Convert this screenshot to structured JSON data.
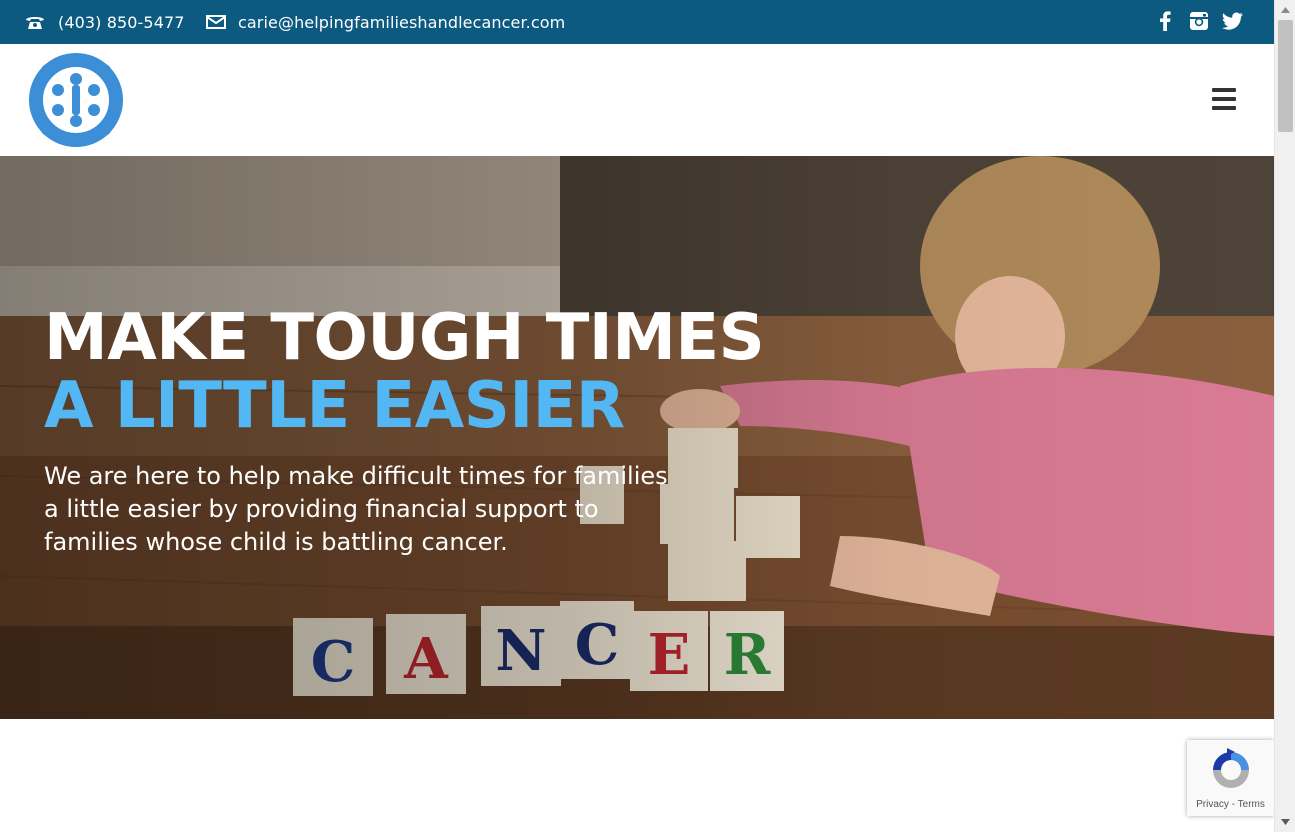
{
  "topbar": {
    "phone": "(403) 850-5477",
    "email": "carie@helpingfamilieshandlecancer.com",
    "social": [
      {
        "icon": "facebook-icon"
      },
      {
        "icon": "instagram-icon"
      },
      {
        "icon": "twitter-icon"
      }
    ],
    "background": "#0d5a80"
  },
  "header": {
    "logo_icon": "circle-of-people-logo",
    "logo_color": "#3c8fd6",
    "menu_icon": "hamburger-icon"
  },
  "hero": {
    "title_line1": "MAKE TOUGH TIMES",
    "title_line2": "A LITTLE EASIER",
    "title_accent": "#52b7f3",
    "text": "We are here to help make difficult times for families a little easier by providing financial support to families whose child is battling cancer.",
    "blocks": [
      "C",
      "A",
      "N",
      "C",
      "E",
      "R"
    ]
  },
  "recaptcha": {
    "privacy": "Privacy",
    "separator": " - ",
    "terms": "Terms"
  }
}
